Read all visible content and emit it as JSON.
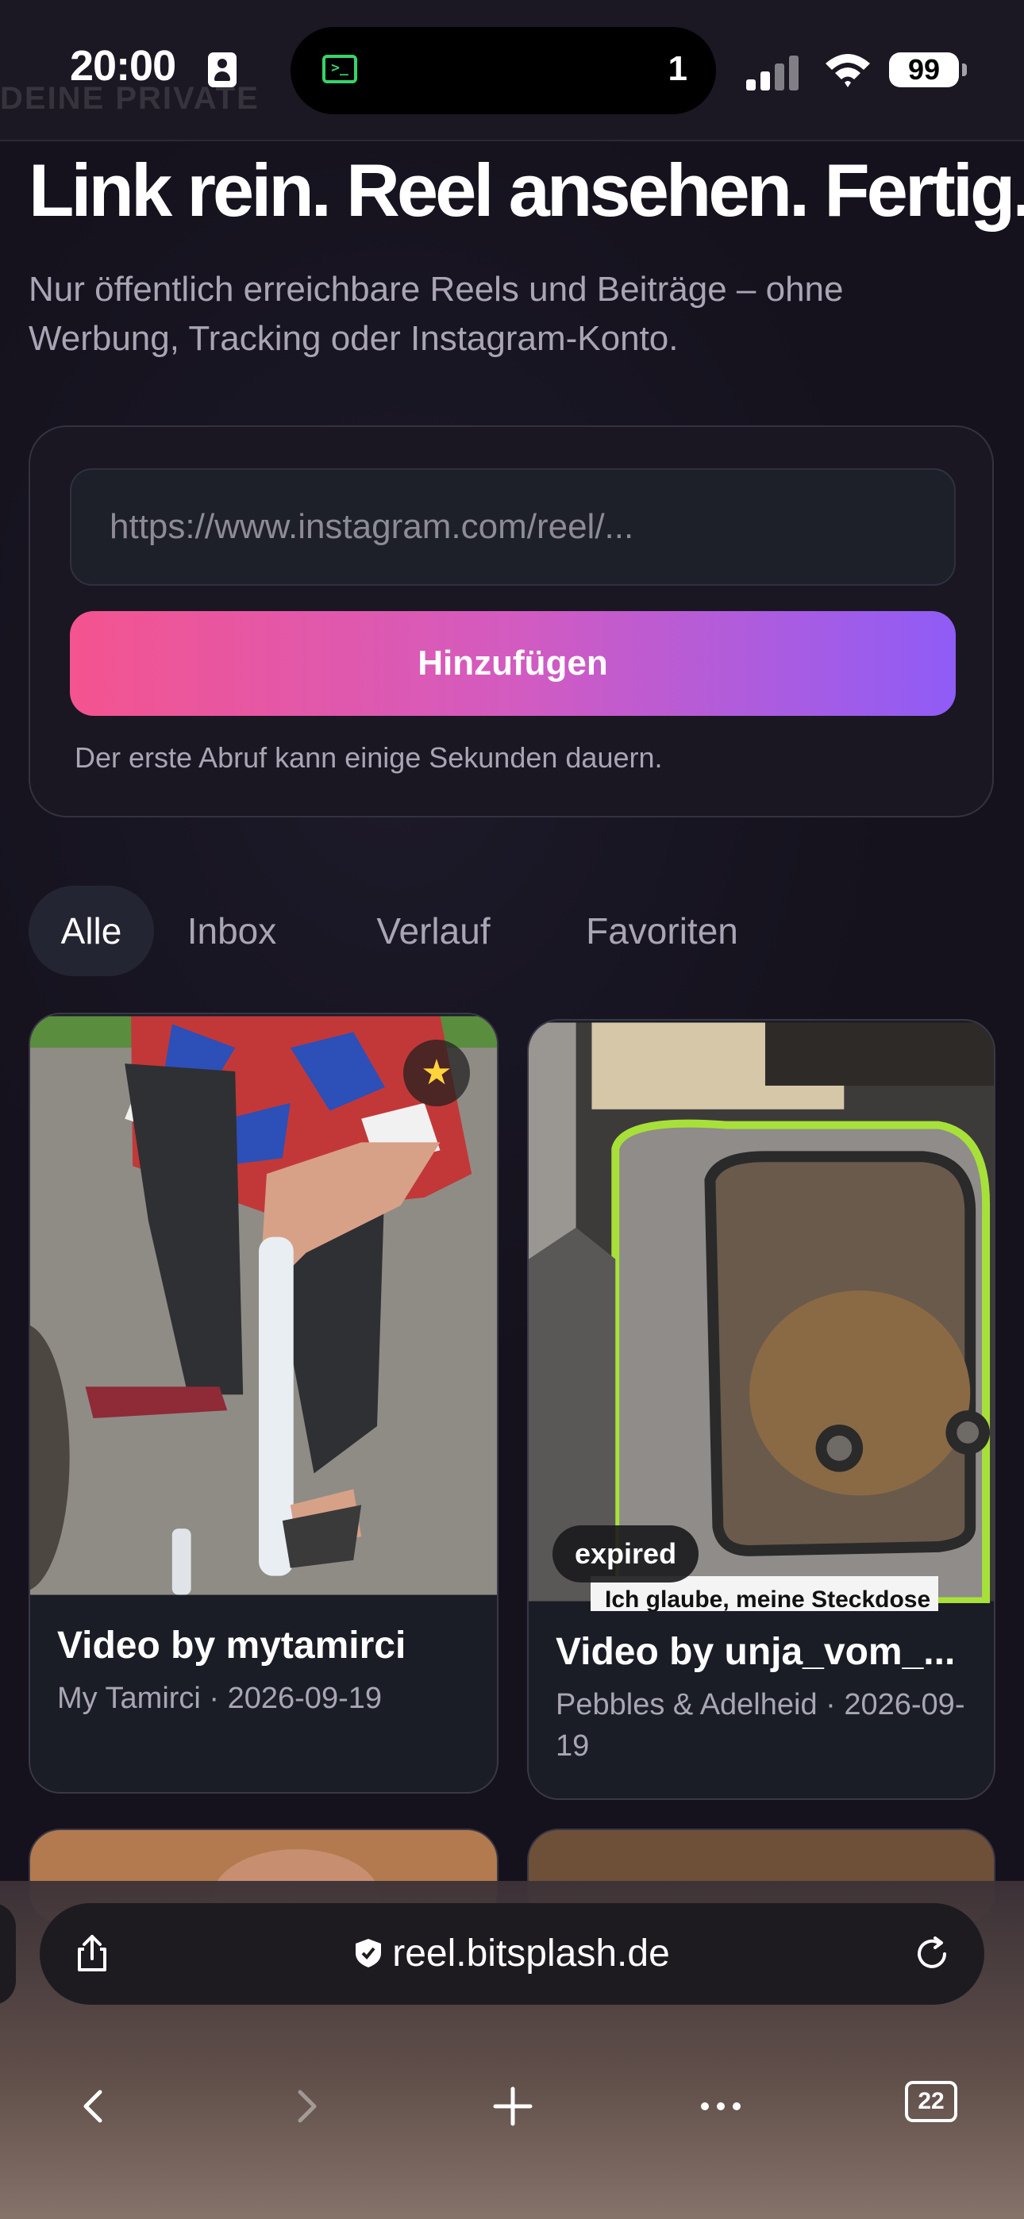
{
  "status_bar": {
    "time": "20:00",
    "island_count": "1",
    "battery": "99"
  },
  "background_heading": "DEINE PRIVATE",
  "hero": {
    "title": "Link rein. Reel ansehen. Fertig.",
    "subtitle": "Nur öffentlich erreichbare Reels und Beiträge – ohne Werbung, Tracking oder Instagram-Konto."
  },
  "form": {
    "url_placeholder": "https://www.instagram.com/reel/...",
    "url_value": "",
    "submit_label": "Hinzufügen",
    "note": "Der erste Abruf kann einige Sekunden dauern."
  },
  "tabs": [
    {
      "label": "Alle",
      "active": true
    },
    {
      "label": "Inbox",
      "active": false
    },
    {
      "label": "Verlauf",
      "active": false
    },
    {
      "label": "Favoriten",
      "active": false
    }
  ],
  "cards": [
    {
      "title": "Video by mytamirci",
      "meta": "My Tamirci · 2026-09-19",
      "favorite": true,
      "badge": ""
    },
    {
      "title": "Video by unja_vom_...",
      "meta": "Pebbles & Adelheid · 2026-09-19",
      "favorite": false,
      "badge": "expired",
      "caption": "Ich glaube, meine Steckdose"
    }
  ],
  "browser": {
    "domain": "reel.bitsplash.de",
    "tab_count": "22"
  },
  "colors": {
    "background": "#15121d",
    "accent_start": "#f4548f",
    "accent_end": "#8f5cf6",
    "favorite_star": "#ffd43b"
  }
}
